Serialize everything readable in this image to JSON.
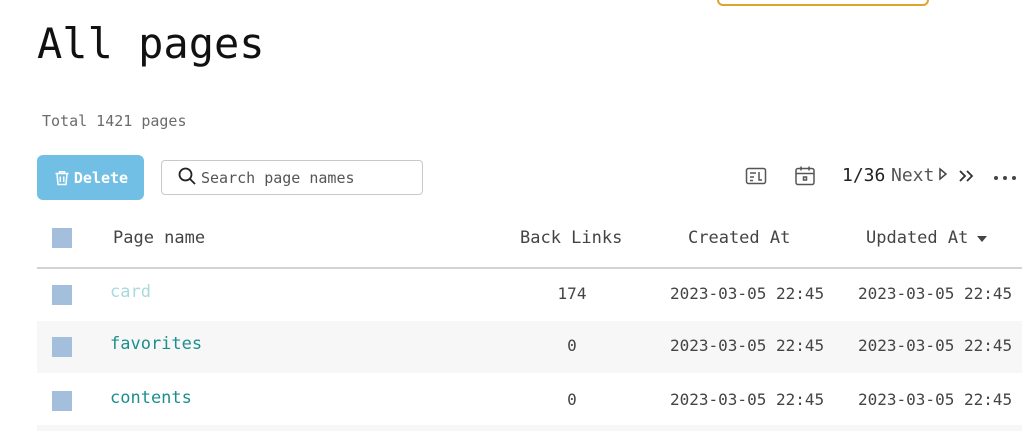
{
  "header": {
    "title": "All pages",
    "total_text": "Total 1421 pages"
  },
  "toolbar": {
    "delete_label": "Delete",
    "search_placeholder": "Search page names",
    "search_value": "",
    "pager_count": "1/36",
    "pager_next_label": "Next"
  },
  "table": {
    "columns": {
      "name": "Page name",
      "backlinks": "Back Links",
      "created": "Created At",
      "updated": "Updated At"
    },
    "rows": [
      {
        "name": "card",
        "backlinks": "174",
        "created": "2023-03-05 22:45",
        "updated": "2023-03-05 22:45"
      },
      {
        "name": "favorites",
        "backlinks": "0",
        "created": "2023-03-05 22:45",
        "updated": "2023-03-05 22:45"
      },
      {
        "name": "contents",
        "backlinks": "0",
        "created": "2023-03-05 22:45",
        "updated": "2023-03-05 22:45"
      }
    ]
  },
  "colors": {
    "delete_button": "#72bfe6",
    "link": "#1a8f8d",
    "link_visited": "#a9d9dc",
    "checkbox": "#a3bfdc",
    "top_outline": "#e0a32e"
  },
  "icons": {
    "delete": "trash-icon",
    "search": "search-icon",
    "toggle_journals": "card-layout-icon",
    "toggle_dates": "calendar-icon",
    "next": "caret-right-icon",
    "last": "double-chevron-right-icon",
    "more": "more-horizontal-icon",
    "sort": "caret-down-icon"
  }
}
